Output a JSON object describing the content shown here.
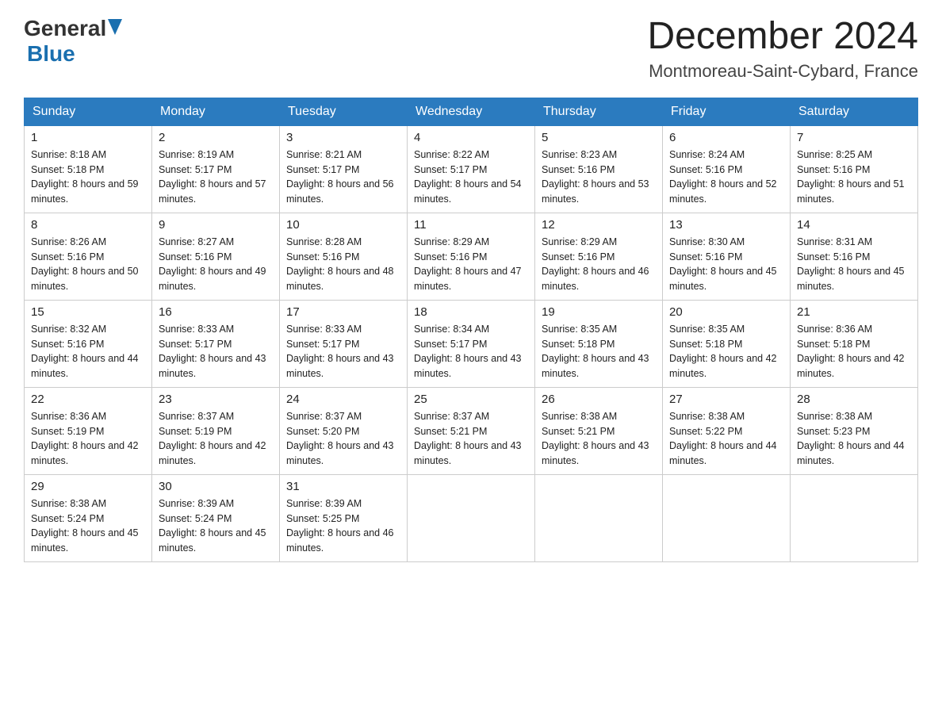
{
  "header": {
    "logo_general": "General",
    "logo_blue": "Blue",
    "month_title": "December 2024",
    "location": "Montmoreau-Saint-Cybard, France"
  },
  "weekdays": [
    "Sunday",
    "Monday",
    "Tuesday",
    "Wednesday",
    "Thursday",
    "Friday",
    "Saturday"
  ],
  "weeks": [
    [
      {
        "day": "1",
        "sunrise": "8:18 AM",
        "sunset": "5:18 PM",
        "daylight": "8 hours and 59 minutes."
      },
      {
        "day": "2",
        "sunrise": "8:19 AM",
        "sunset": "5:17 PM",
        "daylight": "8 hours and 57 minutes."
      },
      {
        "day": "3",
        "sunrise": "8:21 AM",
        "sunset": "5:17 PM",
        "daylight": "8 hours and 56 minutes."
      },
      {
        "day": "4",
        "sunrise": "8:22 AM",
        "sunset": "5:17 PM",
        "daylight": "8 hours and 54 minutes."
      },
      {
        "day": "5",
        "sunrise": "8:23 AM",
        "sunset": "5:16 PM",
        "daylight": "8 hours and 53 minutes."
      },
      {
        "day": "6",
        "sunrise": "8:24 AM",
        "sunset": "5:16 PM",
        "daylight": "8 hours and 52 minutes."
      },
      {
        "day": "7",
        "sunrise": "8:25 AM",
        "sunset": "5:16 PM",
        "daylight": "8 hours and 51 minutes."
      }
    ],
    [
      {
        "day": "8",
        "sunrise": "8:26 AM",
        "sunset": "5:16 PM",
        "daylight": "8 hours and 50 minutes."
      },
      {
        "day": "9",
        "sunrise": "8:27 AM",
        "sunset": "5:16 PM",
        "daylight": "8 hours and 49 minutes."
      },
      {
        "day": "10",
        "sunrise": "8:28 AM",
        "sunset": "5:16 PM",
        "daylight": "8 hours and 48 minutes."
      },
      {
        "day": "11",
        "sunrise": "8:29 AM",
        "sunset": "5:16 PM",
        "daylight": "8 hours and 47 minutes."
      },
      {
        "day": "12",
        "sunrise": "8:29 AM",
        "sunset": "5:16 PM",
        "daylight": "8 hours and 46 minutes."
      },
      {
        "day": "13",
        "sunrise": "8:30 AM",
        "sunset": "5:16 PM",
        "daylight": "8 hours and 45 minutes."
      },
      {
        "day": "14",
        "sunrise": "8:31 AM",
        "sunset": "5:16 PM",
        "daylight": "8 hours and 45 minutes."
      }
    ],
    [
      {
        "day": "15",
        "sunrise": "8:32 AM",
        "sunset": "5:16 PM",
        "daylight": "8 hours and 44 minutes."
      },
      {
        "day": "16",
        "sunrise": "8:33 AM",
        "sunset": "5:17 PM",
        "daylight": "8 hours and 43 minutes."
      },
      {
        "day": "17",
        "sunrise": "8:33 AM",
        "sunset": "5:17 PM",
        "daylight": "8 hours and 43 minutes."
      },
      {
        "day": "18",
        "sunrise": "8:34 AM",
        "sunset": "5:17 PM",
        "daylight": "8 hours and 43 minutes."
      },
      {
        "day": "19",
        "sunrise": "8:35 AM",
        "sunset": "5:18 PM",
        "daylight": "8 hours and 43 minutes."
      },
      {
        "day": "20",
        "sunrise": "8:35 AM",
        "sunset": "5:18 PM",
        "daylight": "8 hours and 42 minutes."
      },
      {
        "day": "21",
        "sunrise": "8:36 AM",
        "sunset": "5:18 PM",
        "daylight": "8 hours and 42 minutes."
      }
    ],
    [
      {
        "day": "22",
        "sunrise": "8:36 AM",
        "sunset": "5:19 PM",
        "daylight": "8 hours and 42 minutes."
      },
      {
        "day": "23",
        "sunrise": "8:37 AM",
        "sunset": "5:19 PM",
        "daylight": "8 hours and 42 minutes."
      },
      {
        "day": "24",
        "sunrise": "8:37 AM",
        "sunset": "5:20 PM",
        "daylight": "8 hours and 43 minutes."
      },
      {
        "day": "25",
        "sunrise": "8:37 AM",
        "sunset": "5:21 PM",
        "daylight": "8 hours and 43 minutes."
      },
      {
        "day": "26",
        "sunrise": "8:38 AM",
        "sunset": "5:21 PM",
        "daylight": "8 hours and 43 minutes."
      },
      {
        "day": "27",
        "sunrise": "8:38 AM",
        "sunset": "5:22 PM",
        "daylight": "8 hours and 44 minutes."
      },
      {
        "day": "28",
        "sunrise": "8:38 AM",
        "sunset": "5:23 PM",
        "daylight": "8 hours and 44 minutes."
      }
    ],
    [
      {
        "day": "29",
        "sunrise": "8:38 AM",
        "sunset": "5:24 PM",
        "daylight": "8 hours and 45 minutes."
      },
      {
        "day": "30",
        "sunrise": "8:39 AM",
        "sunset": "5:24 PM",
        "daylight": "8 hours and 45 minutes."
      },
      {
        "day": "31",
        "sunrise": "8:39 AM",
        "sunset": "5:25 PM",
        "daylight": "8 hours and 46 minutes."
      },
      null,
      null,
      null,
      null
    ]
  ]
}
